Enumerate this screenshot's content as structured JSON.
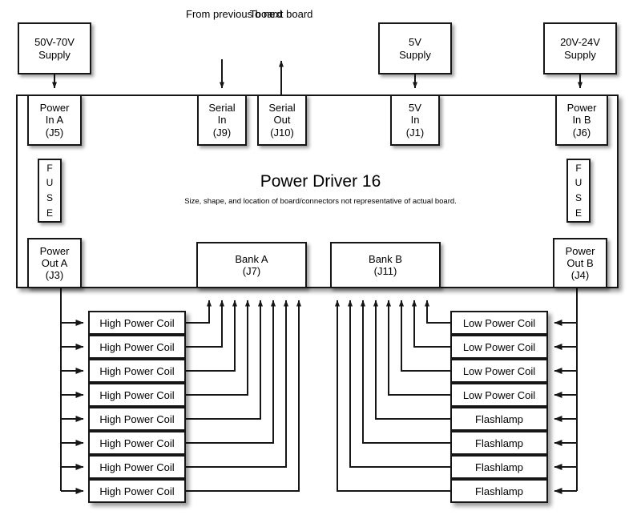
{
  "diagram": {
    "title": "Power Driver 16",
    "subtitle": "Size, shape, and location of board/connectors not representative of actual board.",
    "stroke_color": "#161616",
    "fill_color": "#ffffff",
    "background": "#ffffff"
  },
  "supplies": [
    {
      "id": "supply-hv",
      "line1": "50V-70V",
      "line2": "Supply"
    },
    {
      "id": "supply-5v",
      "line1": "5V",
      "line2": "Supply"
    },
    {
      "id": "supply-lv",
      "line1": "20V-24V",
      "line2": "Supply"
    }
  ],
  "annotations": [
    {
      "id": "from-previous-board",
      "line1": "From",
      "line2": "previous",
      "line3": "board"
    },
    {
      "id": "to-next-board",
      "line1": "To",
      "line2": "next",
      "line3": "board"
    }
  ],
  "connectors": [
    {
      "id": "power-in-a",
      "line1": "Power",
      "line2": "In A",
      "ref": "(J5)"
    },
    {
      "id": "serial-in",
      "line1": "Serial",
      "line2": "In",
      "ref": "(J9)"
    },
    {
      "id": "serial-out",
      "line1": "Serial",
      "line2": "Out",
      "ref": "(J10)"
    },
    {
      "id": "five-volt-in",
      "line1": "5V",
      "line2": "In",
      "ref": "(J1)"
    },
    {
      "id": "power-in-b",
      "line1": "Power",
      "line2": "In B",
      "ref": "(J6)"
    },
    {
      "id": "power-out-a",
      "line1": "Power",
      "line2": "Out A",
      "ref": "(J3)"
    },
    {
      "id": "power-out-b",
      "line1": "Power",
      "line2": "Out B",
      "ref": "(J4)"
    },
    {
      "id": "bank-a",
      "line1": "Bank A",
      "line2": "",
      "ref": "(J7)"
    },
    {
      "id": "bank-b",
      "line1": "Bank B",
      "line2": "",
      "ref": "(J11)"
    }
  ],
  "fuses": [
    {
      "id": "fuse-a",
      "letters": [
        "F",
        "U",
        "S",
        "E"
      ]
    },
    {
      "id": "fuse-b",
      "letters": [
        "F",
        "U",
        "S",
        "E"
      ]
    }
  ],
  "left_loads": [
    {
      "label": "High Power Coil"
    },
    {
      "label": "High Power Coil"
    },
    {
      "label": "High Power Coil"
    },
    {
      "label": "High Power Coil"
    },
    {
      "label": "High Power Coil"
    },
    {
      "label": "High Power Coil"
    },
    {
      "label": "High Power Coil"
    },
    {
      "label": "High Power Coil"
    }
  ],
  "right_loads": [
    {
      "label": "Low Power Coil"
    },
    {
      "label": "Low Power Coil"
    },
    {
      "label": "Low Power Coil"
    },
    {
      "label": "Low Power Coil"
    },
    {
      "label": "Flashlamp"
    },
    {
      "label": "Flashlamp"
    },
    {
      "label": "Flashlamp"
    },
    {
      "label": "Flashlamp"
    }
  ]
}
